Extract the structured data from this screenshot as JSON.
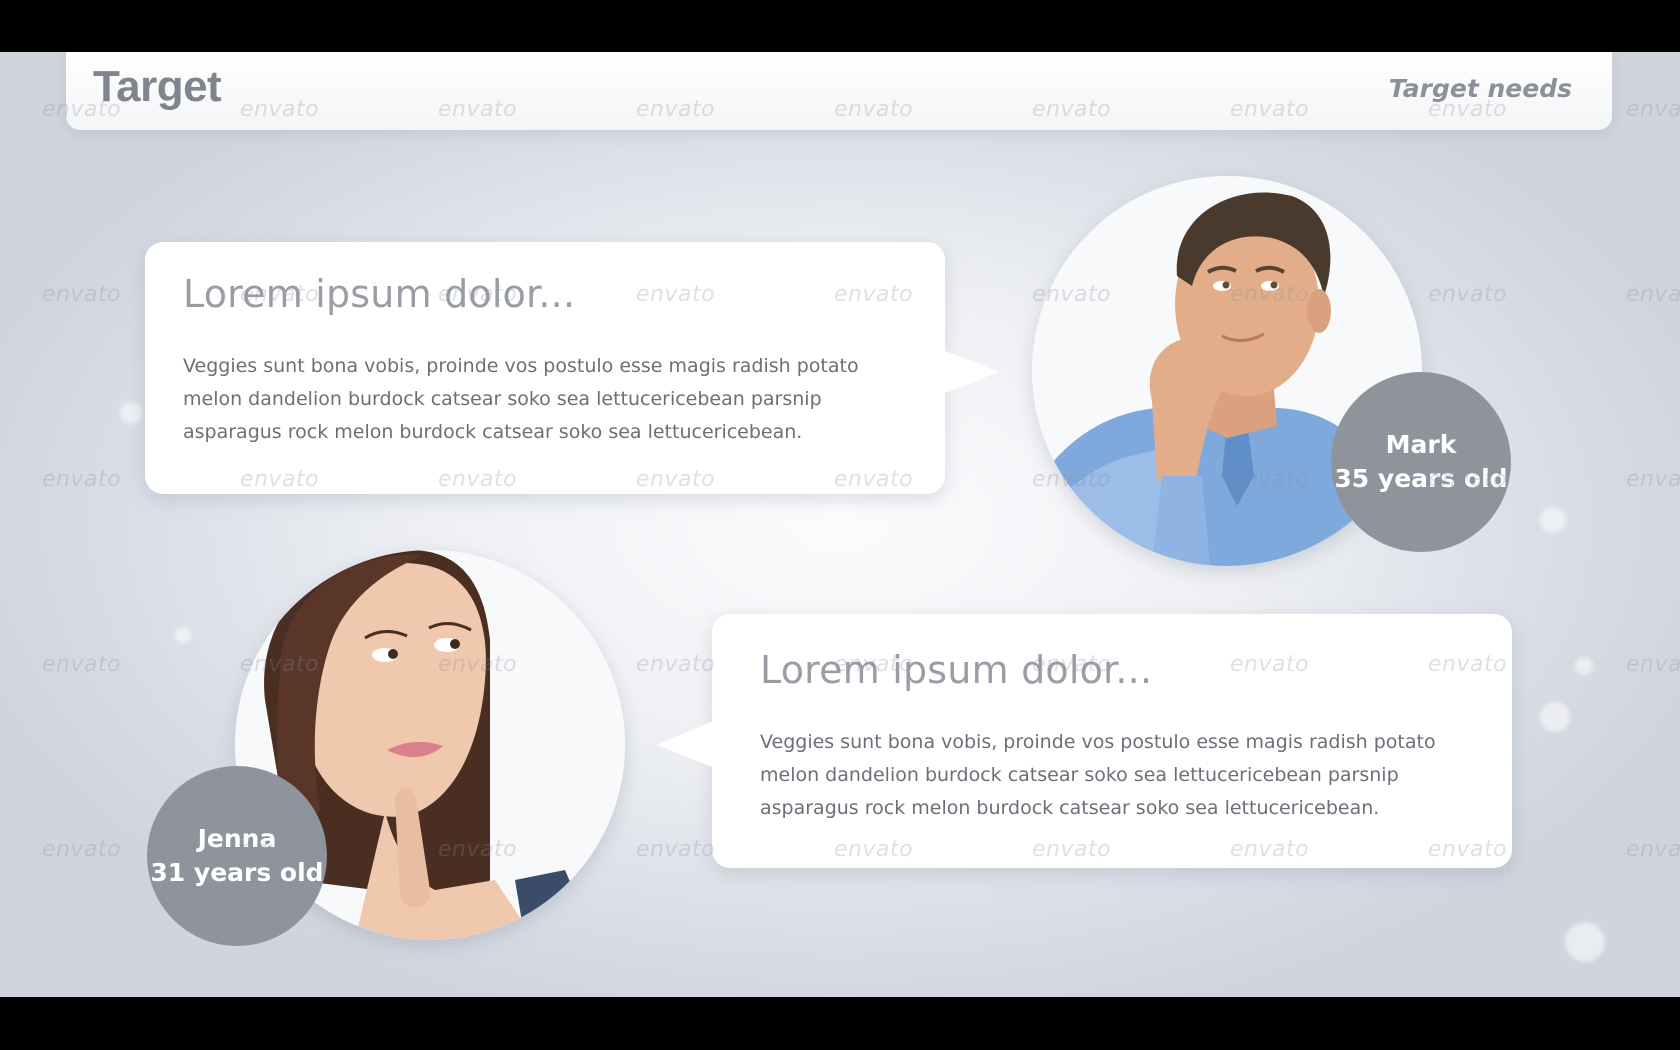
{
  "header": {
    "title": "Target",
    "subtitle": "Target needs"
  },
  "watermark": "envato",
  "cards": [
    {
      "title": "Lorem ipsum dolor...",
      "text": "Veggies sunt bona vobis, proinde vos postulo esse magis radish potato melon dandelion burdock catsear soko sea lettucericebean parsnip asparagus rock melon burdock catsear soko sea lettucericebean.",
      "person": {
        "name": "Mark",
        "age": "35 years old"
      }
    },
    {
      "title": "Lorem ipsum dolor...",
      "text": "Veggies sunt bona vobis, proinde vos postulo esse magis radish potato melon dandelion burdock catsear soko sea lettucericebean parsnip asparagus rock melon burdock catsear soko sea lettucericebean.",
      "person": {
        "name": "Jenna",
        "age": "31 years old"
      }
    }
  ],
  "colors": {
    "badge": "#8f939b",
    "title_text": "#999da5",
    "body_text": "#6b6f77",
    "background": "#eef0f4"
  }
}
